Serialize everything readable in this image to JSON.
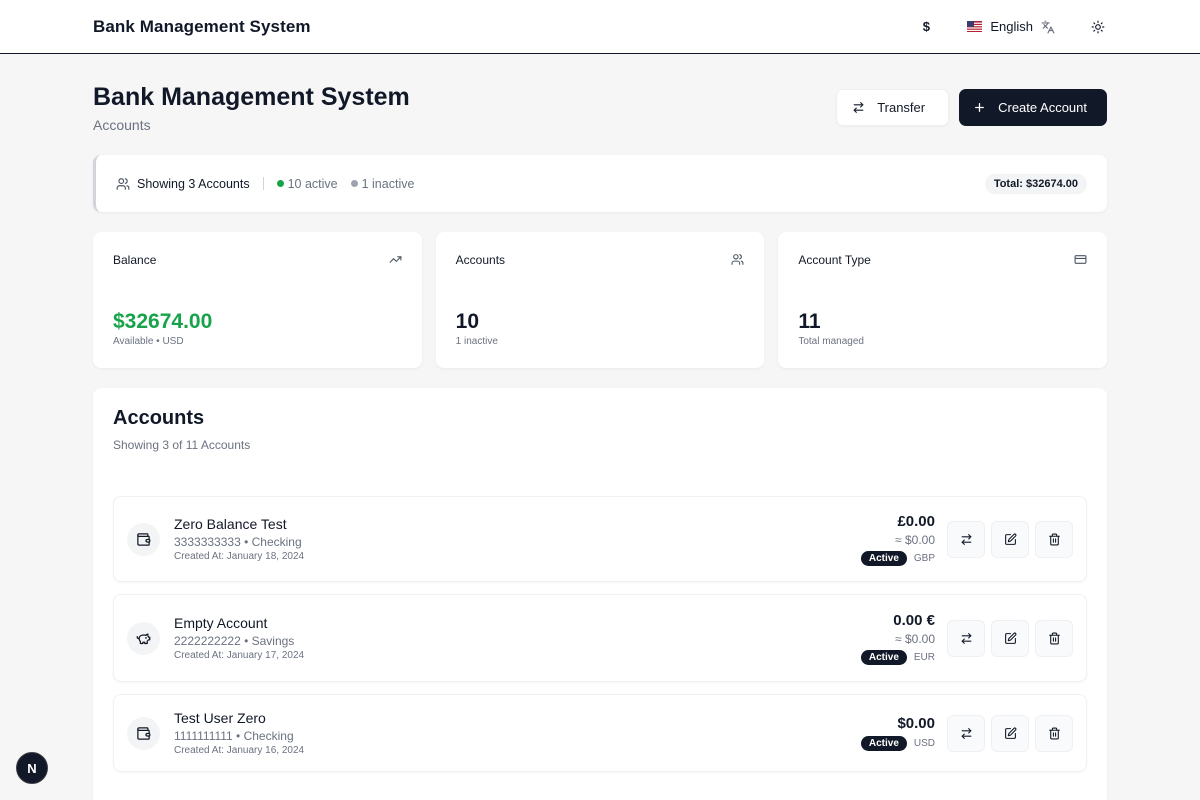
{
  "topnav": {
    "brand": "Bank Management System",
    "currency_symbol": "$",
    "language": "English",
    "flag_icon": "us-flag-icon",
    "translate_icon": "translate-icon",
    "theme_icon": "sun-icon"
  },
  "header": {
    "title": "Bank Management System",
    "subtitle": "Accounts",
    "transfer_label": "Transfer",
    "create_label": "Create Account"
  },
  "summary": {
    "showing": "Showing 3 Accounts",
    "active": "10 active",
    "inactive": "1 inactive",
    "total": "Total: $32674.00"
  },
  "stats": {
    "balance": {
      "label": "Balance",
      "value": "$32674.00",
      "sub": "Available • USD",
      "icon": "trending-up-icon"
    },
    "accounts": {
      "label": "Accounts",
      "value": "10",
      "sub": "1 inactive",
      "icon": "users-icon"
    },
    "account_type": {
      "label": "Account Type",
      "value": "11",
      "sub": "Total managed",
      "icon": "credit-card-icon"
    }
  },
  "accounts": {
    "title": "Accounts",
    "subtitle": "Showing 3 of 11 Accounts",
    "rows": [
      {
        "name": "Zero Balance Test",
        "meta": "3333333333 • Checking",
        "created": "Created At: January 18, 2024",
        "amount": "£0.00",
        "approx": "≈ $0.00",
        "status": "Active",
        "currency": "GBP",
        "icon": "wallet-icon"
      },
      {
        "name": "Empty Account",
        "meta": "2222222222 • Savings",
        "created": "Created At: January 17, 2024",
        "amount": "0.00 €",
        "approx": "≈ $0.00",
        "status": "Active",
        "currency": "EUR",
        "icon": "piggy-bank-icon"
      },
      {
        "name": "Test User Zero",
        "meta": "1111111111 • Checking",
        "created": "Created At: January 16, 2024",
        "amount": "$0.00",
        "approx": "",
        "status": "Active",
        "currency": "USD",
        "icon": "wallet-icon"
      }
    ]
  },
  "dev_badge": "N",
  "colors": {
    "primary": "#111827",
    "positive": "#16a34a",
    "muted": "#6b7280",
    "background": "#f6f6f7"
  }
}
